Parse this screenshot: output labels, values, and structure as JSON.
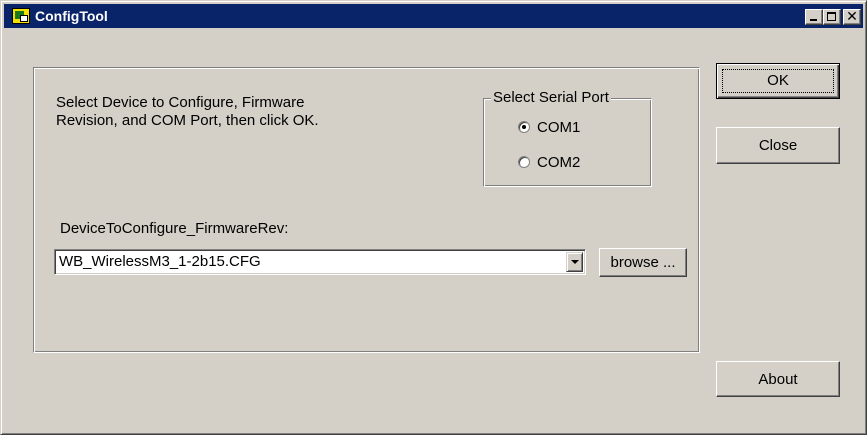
{
  "window": {
    "title": "ConfigTool",
    "title_bar_color": "#0a246a",
    "face_color": "#d4d0c8",
    "caption_buttons": {
      "minimize": "minimize-icon",
      "maximize": "maximize-icon",
      "close": "✕"
    }
  },
  "main": {
    "instruction_line1": "Select Device to Configure, Firmware",
    "instruction_line2": "Revision, and COM Port, then click OK.",
    "serial_port_group": {
      "label": "Select Serial Port",
      "options": [
        {
          "label": "COM1",
          "checked": true
        },
        {
          "label": "COM2",
          "checked": false
        }
      ]
    },
    "device_field": {
      "label": "DeviceToConfigure_FirmwareRev:",
      "value": "WB_WirelessM3_1-2b15.CFG"
    },
    "browse_label": "browse ..."
  },
  "buttons": {
    "ok": "OK",
    "close": "Close",
    "about": "About"
  }
}
